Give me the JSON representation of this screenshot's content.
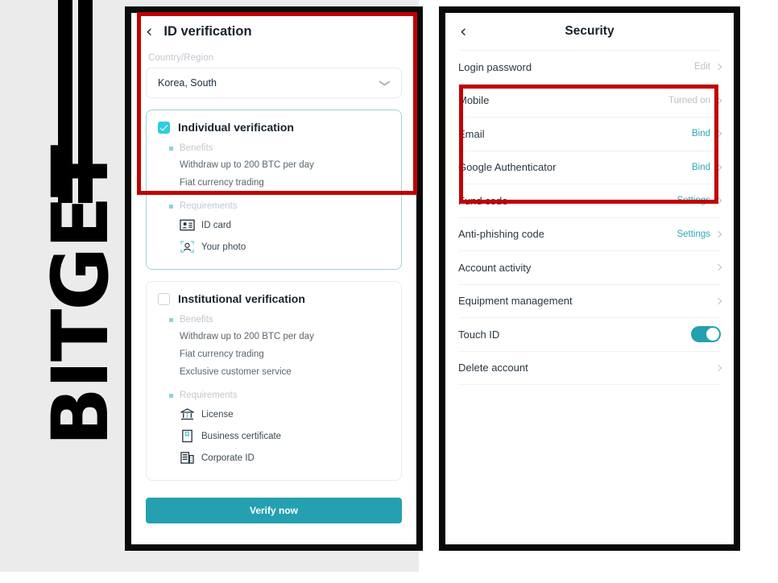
{
  "brand": {
    "name": "BITGET"
  },
  "left_phone": {
    "nav": {
      "back_icon": "chevron-left-icon",
      "title": "ID verification"
    },
    "country": {
      "label": "Country/Region",
      "value": "Korea, South",
      "chevron_icon": "chevron-down-icon"
    },
    "cards": [
      {
        "id": "individual",
        "title": "Individual verification",
        "checked": true,
        "benefits_label": "Benefits",
        "benefits": [
          "Withdraw up to 200 BTC per day",
          "Fiat currency trading"
        ],
        "requirements_label": "Requirements",
        "requirements": [
          {
            "label": "ID card",
            "icon": "id-card-icon"
          },
          {
            "label": "Your photo",
            "icon": "portrait-photo-icon"
          }
        ]
      },
      {
        "id": "institutional",
        "title": "Institutional verification",
        "checked": false,
        "benefits_label": "Benefits",
        "benefits": [
          "Withdraw up to 200 BTC per day",
          "Fiat currency trading",
          "Exclusive customer service"
        ],
        "requirements_label": "Requirements",
        "requirements": [
          {
            "label": "License",
            "icon": "bank-license-icon"
          },
          {
            "label": "Business certificate",
            "icon": "certificate-icon"
          },
          {
            "label": "Corporate ID",
            "icon": "corporate-building-icon"
          }
        ]
      }
    ],
    "cta": {
      "label": "Verify now"
    }
  },
  "right_phone": {
    "nav": {
      "back_icon": "chevron-left-icon",
      "title": "Security"
    },
    "rows": [
      {
        "label": "Login password",
        "value": "Edit",
        "value_style": "muted",
        "control": "arrow"
      },
      {
        "label": "Mobile",
        "value": "Turned on",
        "value_style": "muted",
        "control": "arrow"
      },
      {
        "label": "Email",
        "value": "Bind",
        "value_style": "link",
        "control": "arrow"
      },
      {
        "label": "Google Authenticator",
        "value": "Bind",
        "value_style": "link",
        "control": "arrow"
      },
      {
        "label": "Fund code",
        "value": "Settings",
        "value_style": "link",
        "control": "arrow"
      },
      {
        "label": "Anti-phishing code",
        "value": "Settings",
        "value_style": "link",
        "control": "arrow"
      },
      {
        "label": "Account activity",
        "value": "",
        "value_style": "muted",
        "control": "arrow"
      },
      {
        "label": "Equipment management",
        "value": "",
        "value_style": "muted",
        "control": "arrow"
      },
      {
        "label": "Touch ID",
        "value": "",
        "value_style": "muted",
        "control": "toggle-on"
      },
      {
        "label": "Delete account",
        "value": "",
        "value_style": "muted",
        "control": "arrow"
      }
    ]
  },
  "annotations": {
    "left_box_color": "#c00000",
    "right_box_color": "#c00000"
  },
  "colors": {
    "accent_teal": "#24a0b0",
    "checkbox_cyan": "#2ecde0",
    "link_teal": "#2ba9b5",
    "backdrop_grey": "#ebebeb"
  }
}
